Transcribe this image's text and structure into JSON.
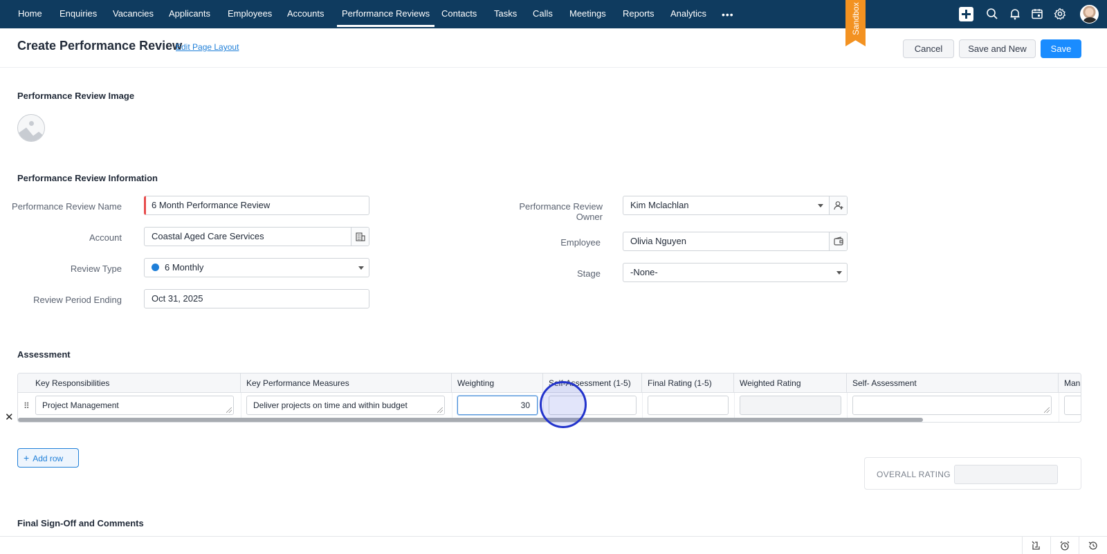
{
  "nav": {
    "items": [
      {
        "label": "Home"
      },
      {
        "label": "Enquiries"
      },
      {
        "label": "Vacancies"
      },
      {
        "label": "Applicants"
      },
      {
        "label": "Employees"
      },
      {
        "label": "Accounts"
      },
      {
        "label": "Performance Reviews",
        "active": true
      },
      {
        "label": "Contacts"
      },
      {
        "label": "Tasks"
      },
      {
        "label": "Calls"
      },
      {
        "label": "Meetings"
      },
      {
        "label": "Reports"
      },
      {
        "label": "Analytics"
      }
    ],
    "more_label": "•••",
    "icons": [
      "plus-icon",
      "search-icon",
      "bell-icon",
      "calendar-icon",
      "gear-icon",
      "user-avatar"
    ],
    "bg_color": "#0f3b5f"
  },
  "sandbox_label": "Sandbox",
  "header": {
    "title": "Create Performance Review",
    "edit_layout_link": "Edit Page Layout",
    "cancel_label": "Cancel",
    "save_new_label": "Save and New",
    "save_label": "Save"
  },
  "image_section": {
    "title": "Performance Review Image"
  },
  "info_section": {
    "title": "Performance Review Information",
    "fields": {
      "name": {
        "label": "Performance Review Name",
        "value": "6 Month Performance Review"
      },
      "account": {
        "label": "Account",
        "value": "Coastal Aged Care Services"
      },
      "review_type": {
        "label": "Review Type",
        "value": "6 Monthly",
        "dot_color": "#1f7fd8"
      },
      "period_ending": {
        "label": "Review Period Ending",
        "value": "Oct 31, 2025"
      },
      "owner": {
        "label_line1": "Performance Review",
        "label_line2": "Owner",
        "value": "Kim Mclachlan"
      },
      "employee": {
        "label": "Employee",
        "value": "Olivia Nguyen"
      },
      "stage": {
        "label": "Stage",
        "value": "-None-"
      }
    }
  },
  "assessment": {
    "title": "Assessment",
    "columns": [
      "Key Responsibilities",
      "Key Performance Measures",
      "Weighting",
      "Self-Assessment (1-5)",
      "Final Rating (1-5)",
      "Weighted Rating",
      "Self- Assessment",
      "Manager"
    ],
    "rows": [
      {
        "key_responsibilities": "Project Management",
        "key_performance_measures": "Deliver projects on time and within budget",
        "weighting": "30",
        "self_assessment_rating": "",
        "final_rating": "",
        "weighted_rating": "",
        "self_assessment": "",
        "manager": ""
      }
    ],
    "add_row_label": "Add row",
    "overall_rating_label": "OVERALL RATING",
    "overall_rating_value": ""
  },
  "signoff_section": {
    "title": "Final Sign-Off and Comments"
  },
  "bottom_bar_icons": [
    "clip-icon",
    "alarm-icon",
    "history-icon"
  ]
}
